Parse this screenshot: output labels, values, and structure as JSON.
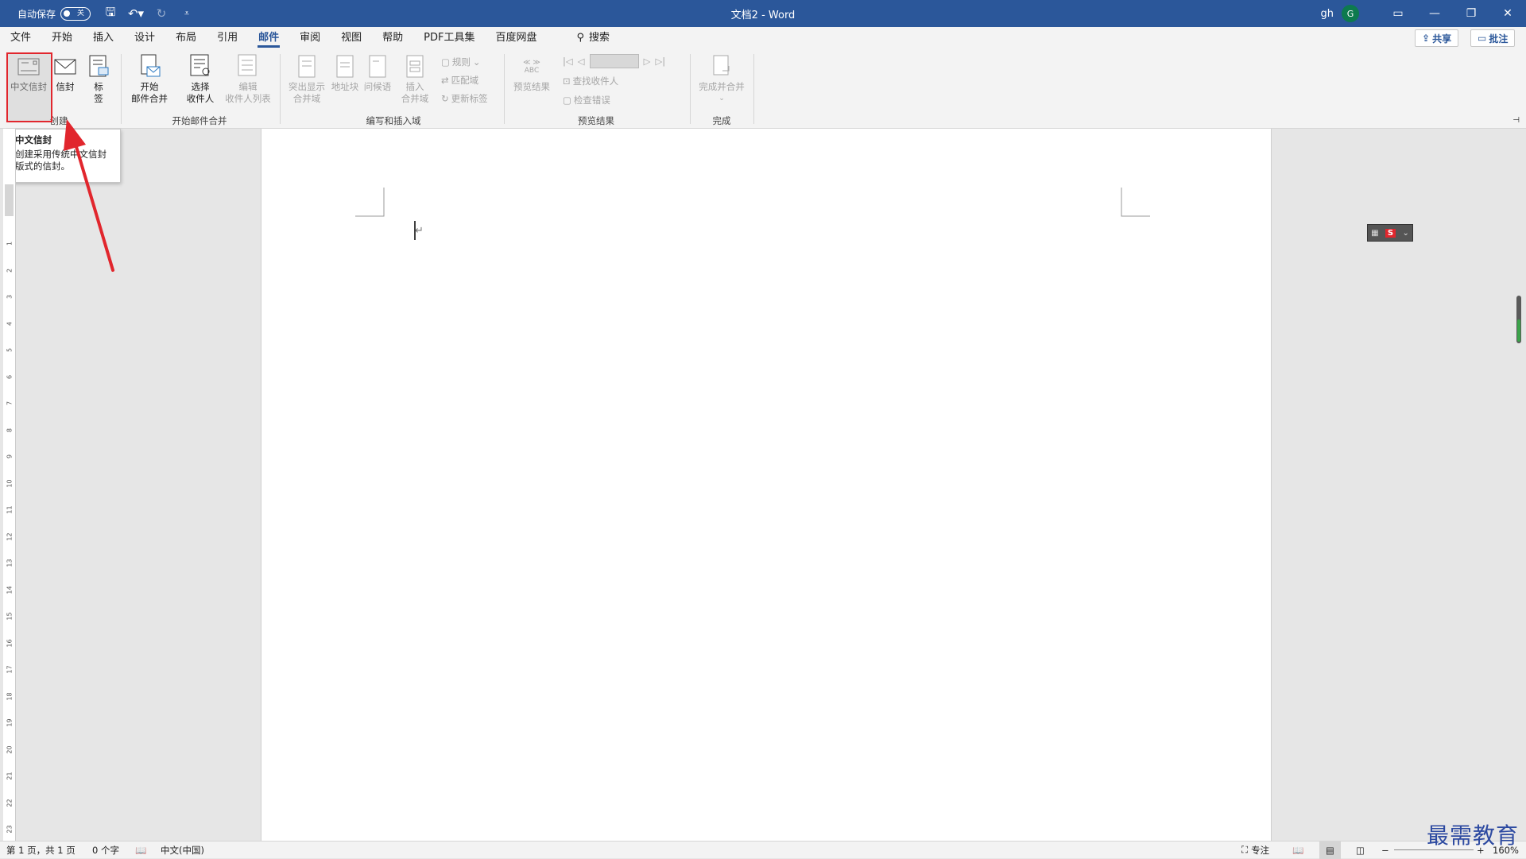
{
  "titlebar": {
    "autosave_label": "自动保存",
    "autosave_state": "关",
    "doc_title": "文档2  -  Word",
    "user": "gh",
    "avatar_letter": "G"
  },
  "tabs": [
    "文件",
    "开始",
    "插入",
    "设计",
    "布局",
    "引用",
    "邮件",
    "审阅",
    "视图",
    "帮助",
    "PDF工具集",
    "百度网盘"
  ],
  "active_tab": "邮件",
  "search_label": "搜索",
  "share_label": "共享",
  "comment_label": "批注",
  "ribbon": {
    "create": {
      "chinese_envelope": "中文信封",
      "envelope": "信封",
      "label_1": "标",
      "label_2": "签",
      "group": "创建"
    },
    "start_merge": {
      "start_1": "开始",
      "start_2": "邮件合并",
      "select_1": "选择",
      "select_2": "收件人",
      "edit_1": "编辑",
      "edit_2": "收件人列表",
      "group": "开始邮件合并"
    },
    "write_insert": {
      "highlight_1": "突出显示",
      "highlight_2": "合并域",
      "address": "地址块",
      "greeting": "问候语",
      "insert_1": "插入",
      "insert_2": "合并域",
      "rules": "规则",
      "match": "匹配域",
      "update": "更新标签",
      "group": "编写和插入域"
    },
    "preview": {
      "preview_results": "预览结果",
      "abc": "ABC",
      "find": "查找收件人",
      "check": "检查错误",
      "group": "预览结果"
    },
    "finish": {
      "finish_merge": "完成并合并",
      "group": "完成"
    }
  },
  "tooltip": {
    "title": "中文信封",
    "desc_1": "创建采用传统中文信封",
    "desc_2": "版式的信封。"
  },
  "ruler_numbers": [
    "1",
    "2",
    "3",
    "4",
    "5",
    "6",
    "7",
    "8",
    "9",
    "10",
    "11",
    "12",
    "13",
    "14",
    "15",
    "16",
    "17",
    "18",
    "19",
    "20",
    "21",
    "22",
    "23"
  ],
  "statusbar": {
    "page": "第 1 页，共 1 页",
    "words": "0 个字",
    "lang": "中文(中国)",
    "focus": "专注",
    "zoom": "160%"
  },
  "watermark": "最需教育",
  "colors": {
    "title_bar": "#2b579a",
    "highlight_box": "#e1262d",
    "arrow": "#e1262d"
  }
}
